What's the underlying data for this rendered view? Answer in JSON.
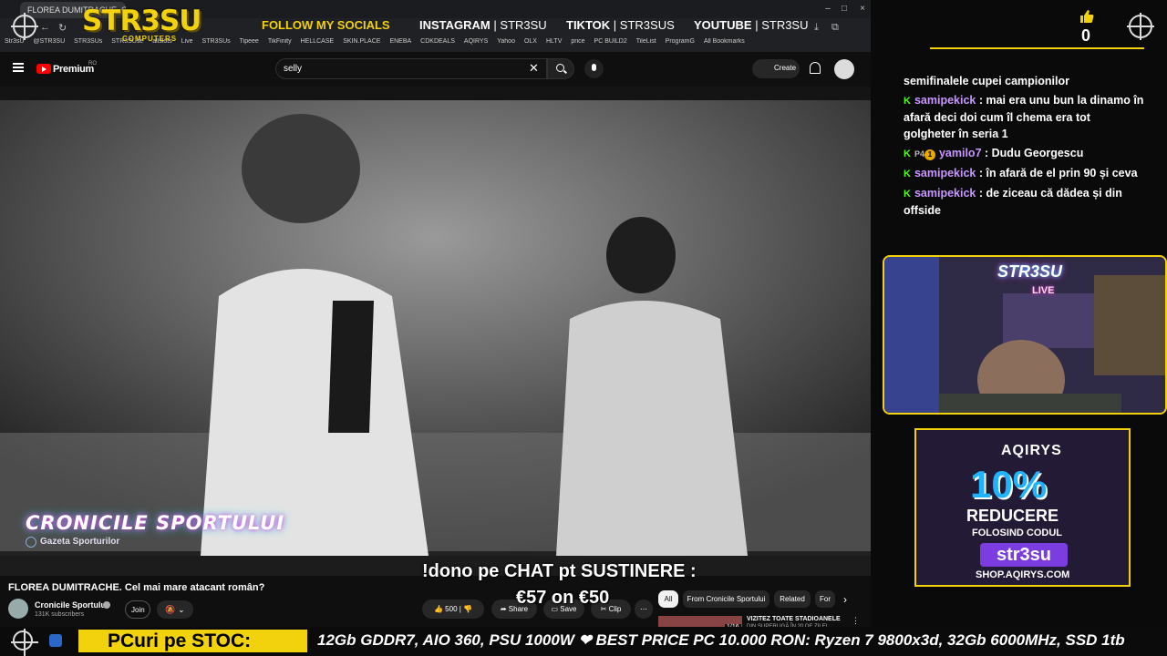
{
  "browser": {
    "tab_title": "FLOREA DUMITRACHE. Cel...",
    "bookmarks": [
      "Str3sU",
      "@STR3SU",
      "STR3SUs",
      "STR3SUse",
      "allslots",
      "Live",
      "STR3SUs",
      "Tipeee",
      "TikFinity",
      "HELLCASE",
      "SKIN.PLACE",
      "ENEBA",
      "CDKDEALS",
      "AQIRYS",
      "Yahoo",
      "OLX",
      "HLTV",
      "price",
      "PC BUILD2",
      "TileList",
      "ProgramG",
      "All Bookmarks"
    ]
  },
  "overlay": {
    "brand": "STR3SU",
    "brand_sub": "COMPUTERS",
    "follow": "FOLLOW MY SOCIALS",
    "socials": [
      {
        "platform": "INSTAGRAM",
        "handle": "STR3SU"
      },
      {
        "platform": "TIKTOK",
        "handle": "STR3SUS"
      },
      {
        "platform": "YOUTUBE",
        "handle": "STR3SU"
      }
    ],
    "likes": "0",
    "donate_line1": "!dono pe CHAT pt SUSTINERE :",
    "donate_line2": "€57 on €50",
    "ticker_label": "PCuri pe STOC:",
    "ticker_text": "12Gb GDDR7, AIO 360, PSU 1000W  ❤ BEST PRICE PC 10.000 RON: Ryzen 7 9800x3d, 32Gb 6000MHz, SSD 1tb"
  },
  "youtube": {
    "premium_label": "Premium",
    "region": "RO",
    "search_value": "selly",
    "create_label": "Create",
    "video_title": "FLOREA DUMITRACHE. Cel mai mare atacant român?",
    "channel_name": "Cronicile Sportului",
    "subscribers": "131K subscribers",
    "join_label": "Join",
    "like_count": "500",
    "share_label": "Share",
    "save_label": "Save",
    "clip_label": "Clip",
    "chips": [
      "All",
      "From Cronicile Sportului",
      "Related",
      "For"
    ],
    "watermark": "CRONICILE SPORTULUI",
    "watermark_sub": "Gazeta Sporturilor",
    "recommended": {
      "title": "VIZITEZ TOATE STADIOANELE",
      "subtitle": "DIN SUPERLIGĂ ÎN 20 DE ZILE!",
      "duration": "1/16"
    }
  },
  "chat": {
    "messages": [
      {
        "badges": "",
        "user": "",
        "text": "semifinalele cupei campionilor"
      },
      {
        "badges": "K",
        "user": "samipekick",
        "text": "mai era unu bun la dinamo în afară deci doi cum îl chema era tot golgheter în seria 1"
      },
      {
        "badges": "K P4 1",
        "user": "yamilo7",
        "text": "Dudu Georgescu"
      },
      {
        "badges": "K",
        "user": "samipekick",
        "text": "în afară de el prin 90 și ceva"
      },
      {
        "badges": "K",
        "user": "samipekick",
        "text": "de ziceau că dădea și din offside"
      }
    ]
  },
  "webcam": {
    "logo": "STR3SU",
    "live": "LIVE"
  },
  "ad": {
    "brand": "AQIRYS",
    "percent": "10%",
    "reducere": "REDUCERE",
    "folosind": "FOLOSIND CODUL",
    "code": "str3su",
    "url": "SHOP.AQIRYS.COM"
  },
  "colors": {
    "accent": "#f2d20c",
    "chat_user": "#c897ff",
    "kick_green": "#53fc18",
    "yt_red": "#ff0000"
  }
}
